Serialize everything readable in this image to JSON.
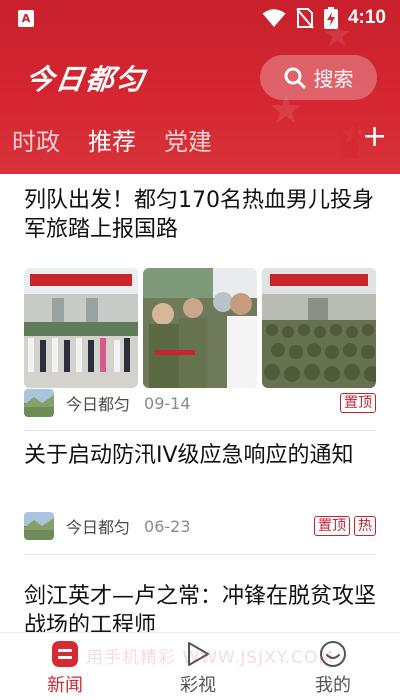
{
  "colors": {
    "brand_red": "#d32a33",
    "tag_red": "#c8202c"
  },
  "status_bar": {
    "time": "4:10",
    "app_badge": "A"
  },
  "header": {
    "logo_text": "今日都匀",
    "search_label": "搜索",
    "search_icon": "search-icon"
  },
  "tabs": [
    {
      "label": "时政",
      "active": false
    },
    {
      "label": "推荐",
      "active": true
    },
    {
      "label": "党建",
      "active": false
    }
  ],
  "add_tab_label": "+",
  "articles": [
    {
      "title": "列队出发！都匀170名热血男儿投身军旅踏上报国路",
      "source": "今日都匀",
      "date": "09-14",
      "tags": [
        "置顶"
      ],
      "image_count": 3
    },
    {
      "title": "关于启动防汛IV级应急响应的通知",
      "source": "今日都匀",
      "date": "06-23",
      "tags": [
        "置顶",
        "热"
      ]
    },
    {
      "title": "剑江英才—卢之常：冲锋在脱贫攻坚战场的工程师"
    }
  ],
  "bottom_nav": [
    {
      "label": "新闻",
      "icon": "news-icon",
      "active": true
    },
    {
      "label": "彩视",
      "icon": "play-icon",
      "active": false
    },
    {
      "label": "我的",
      "icon": "smile-icon",
      "active": false
    }
  ],
  "watermark": "用手机精彩 WWW.JSJXY.COM"
}
